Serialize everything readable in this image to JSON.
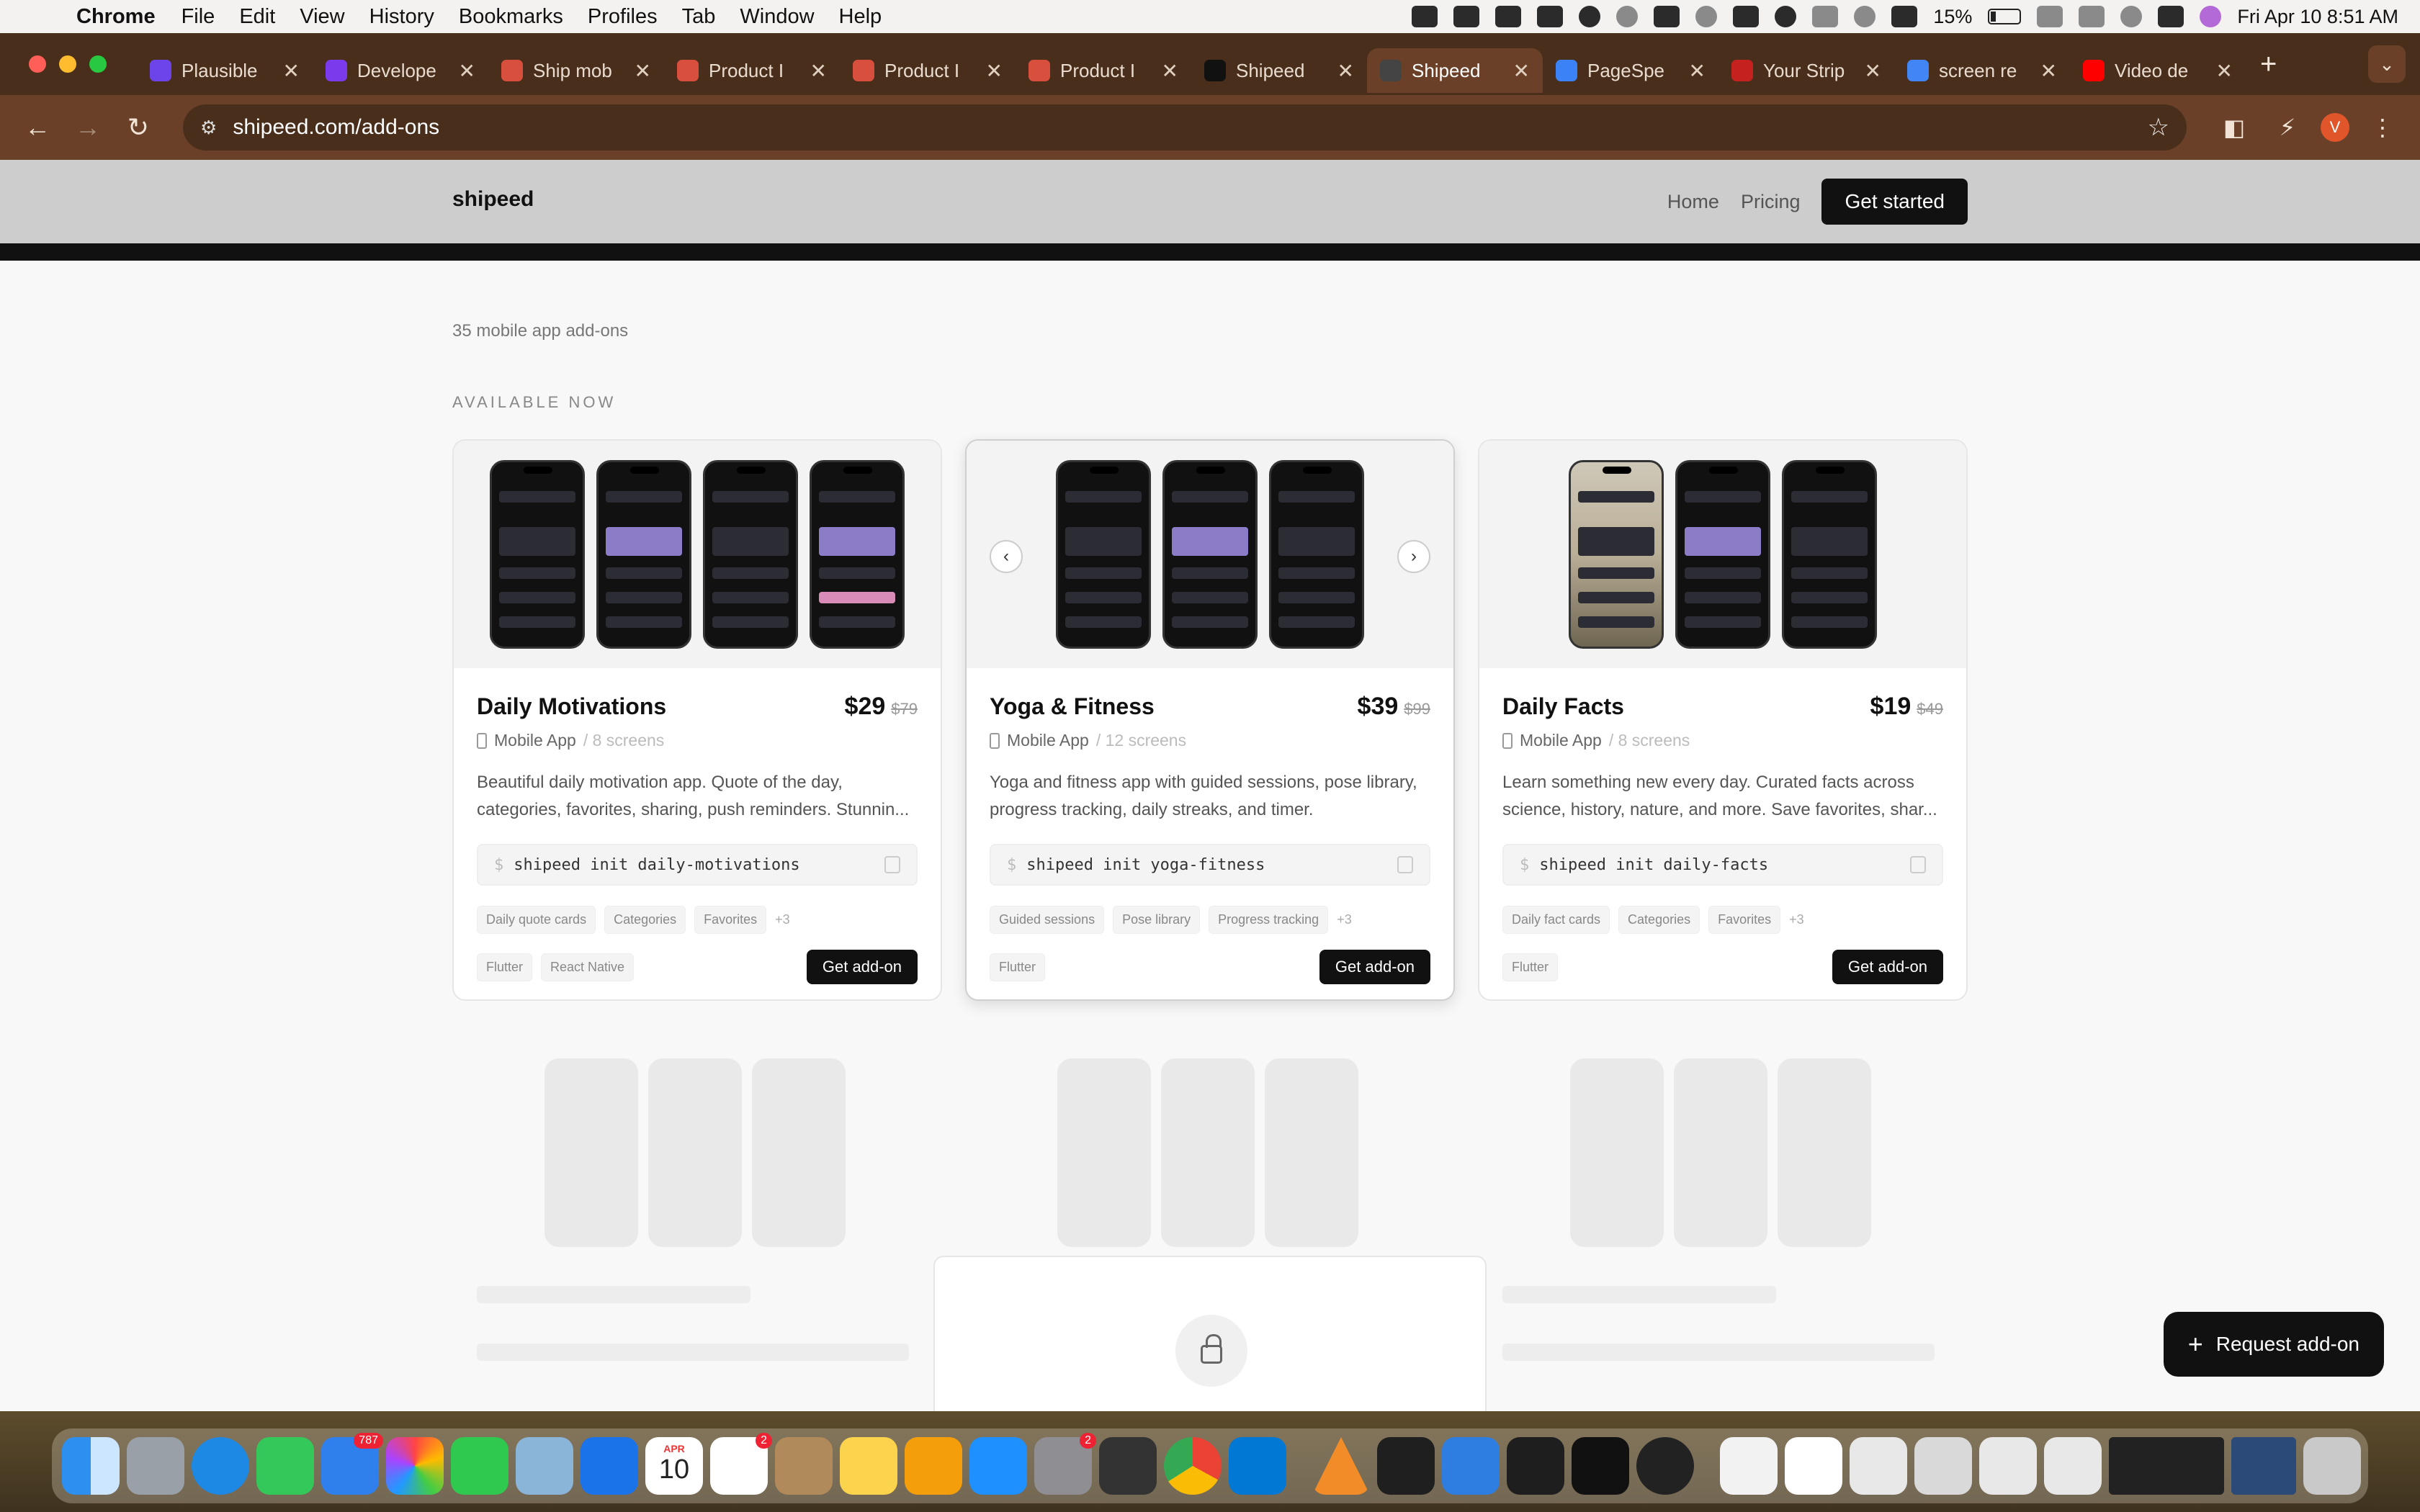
{
  "menubar": {
    "app_name": "Chrome",
    "menus": [
      "File",
      "Edit",
      "View",
      "History",
      "Bookmarks",
      "Profiles",
      "Tab",
      "Window",
      "Help"
    ],
    "battery": "15%",
    "datetime": "Fri Apr 10  8:51 AM"
  },
  "browser": {
    "tabs": [
      {
        "title": "Plausible",
        "color": "#6d44ea"
      },
      {
        "title": "Develope",
        "color": "#7c3aed"
      },
      {
        "title": "Ship mob",
        "color": "#d94f3d"
      },
      {
        "title": "Product I",
        "color": "#d94f3d"
      },
      {
        "title": "Product I",
        "color": "#d94f3d"
      },
      {
        "title": "Product I",
        "color": "#d94f3d"
      },
      {
        "title": "Shipeed",
        "color": "#111111"
      },
      {
        "title": "Shipeed",
        "color": "#444444"
      },
      {
        "title": "PageSpe",
        "color": "#3b82f6"
      },
      {
        "title": "Your Strip",
        "color": "#c5221f"
      },
      {
        "title": "screen re",
        "color": "#4285f4"
      },
      {
        "title": "Video de",
        "color": "#ff0000"
      }
    ],
    "url": "shipeed.com/add-ons",
    "profile_initial": "V"
  },
  "site": {
    "logo": "shipeed",
    "nav_home": "Home",
    "nav_pricing": "Pricing",
    "cta": "Get started",
    "count": "35 mobile app add-ons",
    "section": "AVAILABLE NOW",
    "request": "Request add-on"
  },
  "cards": [
    {
      "name": "Daily Motivations",
      "price": "$29",
      "old_price": "$79",
      "platform": "Mobile App",
      "screens": "/ 8 screens",
      "desc": "Beautiful daily motivation app. Quote of the day, categories, favorites, sharing, push reminders. Stunnin...",
      "cmd": "shipeed init daily-motivations",
      "features": [
        "Daily quote cards",
        "Categories",
        "Favorites"
      ],
      "more": "+3",
      "frameworks": [
        "Flutter",
        "React Native"
      ],
      "button": "Get add-on"
    },
    {
      "name": "Yoga & Fitness",
      "price": "$39",
      "old_price": "$99",
      "platform": "Mobile App",
      "screens": "/ 12 screens",
      "desc": "Yoga and fitness app with guided sessions, pose library, progress tracking, daily streaks, and timer.",
      "cmd": "shipeed init yoga-fitness",
      "features": [
        "Guided sessions",
        "Pose library",
        "Progress tracking"
      ],
      "more": "+3",
      "frameworks": [
        "Flutter"
      ],
      "button": "Get add-on"
    },
    {
      "name": "Daily Facts",
      "price": "$19",
      "old_price": "$49",
      "platform": "Mobile App",
      "screens": "/ 8 screens",
      "desc": "Learn something new every day. Curated facts across science, history, nature, and more. Save favorites, shar...",
      "cmd": "shipeed init daily-facts",
      "features": [
        "Daily fact cards",
        "Categories",
        "Favorites"
      ],
      "more": "+3",
      "frameworks": [
        "Flutter"
      ],
      "button": "Get add-on"
    }
  ],
  "dock": {
    "mail_badge": "787",
    "calendar_month": "APR",
    "calendar_day": "10",
    "reminders_badge": "2",
    "settings_badge": "2"
  }
}
